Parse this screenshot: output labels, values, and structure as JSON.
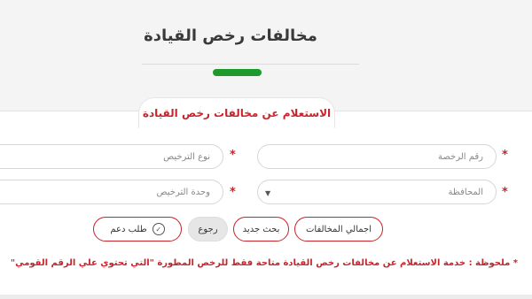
{
  "header": {
    "title": "مخالفات رخص القيادة"
  },
  "form": {
    "tab_label": "الاستعلام عن مخالفات رخص القيادة",
    "required_mark": "*",
    "license_number": {
      "placeholder": "رقم الرخصة"
    },
    "license_type": {
      "placeholder": "نوع الترخيص"
    },
    "governorate": {
      "value": "المحافظة"
    },
    "licensing_unit": {
      "placeholder": "وحدة الترخيص"
    }
  },
  "buttons": {
    "total_violations": "اجمالي المخالفات",
    "new_search": "بحث جديد",
    "back": "رجوع",
    "support_request": "طلب دعم"
  },
  "note": "* ملحوظة : خدمة الاستعلام عن مخالفات رخص القيادة متاحة فقط للرخص المطورة \"التي تحتوي علي الرقم القومي\"",
  "colors": {
    "accent_red": "#c8242b",
    "accent_green": "#1d9a2b"
  },
  "icons": {
    "support": "check-circle-icon",
    "dropdown": "chevron-down-icon"
  }
}
